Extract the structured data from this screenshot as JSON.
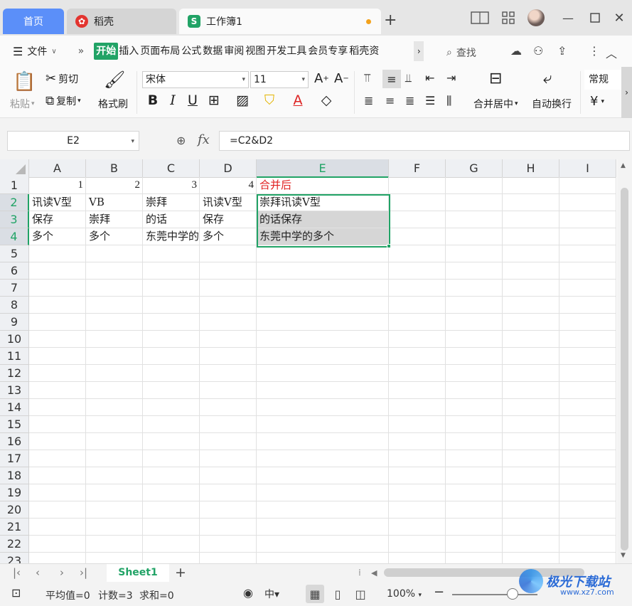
{
  "window": {
    "tabs": [
      {
        "label": "首页"
      },
      {
        "label": "稻壳"
      },
      {
        "label": "工作簿1"
      }
    ],
    "add_tab": "+",
    "user_avatar": "avatar"
  },
  "menubar": {
    "file_label": "文件",
    "tabs": [
      "开始",
      "插入",
      "页面布局",
      "公式",
      "数据",
      "审阅",
      "视图",
      "开发工具",
      "会员专享",
      "稻壳资"
    ],
    "active_tab": "开始",
    "search_label": "查找"
  },
  "ribbon": {
    "paste": "粘贴",
    "cut": "剪切",
    "copy": "复制",
    "format_painter": "格式刷",
    "font_name": "宋体",
    "font_size": "11",
    "merge_center": "合并居中",
    "wrap_text": "自动换行",
    "number_format": "常规",
    "currency_symbol": "¥"
  },
  "formula_bar": {
    "name_box": "E2",
    "fx": "fx",
    "formula": "=C2&D2"
  },
  "sheet": {
    "columns": [
      "A",
      "B",
      "C",
      "D",
      "E",
      "F",
      "G",
      "H",
      "I"
    ],
    "selected_column": "E",
    "rows": [
      "1",
      "2",
      "3",
      "4",
      "5",
      "6",
      "7",
      "8",
      "9",
      "10",
      "11",
      "12",
      "13",
      "14",
      "15",
      "16",
      "17",
      "18",
      "19",
      "20",
      "21",
      "22",
      "23"
    ],
    "cells": {
      "A1": "1",
      "B1": "2",
      "C1": "3",
      "D1": "4",
      "E1": "合并后",
      "A2": "讯读V型",
      "B2": "VB",
      "C2": "崇拜",
      "D2": "讯读V型",
      "E2": "崇拜讯读V型",
      "A3": "保存",
      "B3": "崇拜",
      "C3": "的话",
      "D3": "保存",
      "E3": "的话保存",
      "A4": "多个",
      "B4": "多个",
      "C4": "东莞中学的",
      "D4": "多个",
      "E4": "东莞中学的多个"
    }
  },
  "sheet_tabs": {
    "active": "Sheet1",
    "add": "+"
  },
  "statusbar": {
    "average": "平均值=0",
    "count": "计数=3",
    "sum": "求和=0",
    "zoom": "100%",
    "zoom_level_percent": 100
  },
  "watermark": {
    "text": "极光下载站",
    "sub": "www.xz7.com"
  },
  "colors": {
    "accent_green": "#21a366",
    "home_tab_blue": "#5b8ff9",
    "header_red": "#e02020",
    "selection_fill": "#d6d6d6"
  }
}
